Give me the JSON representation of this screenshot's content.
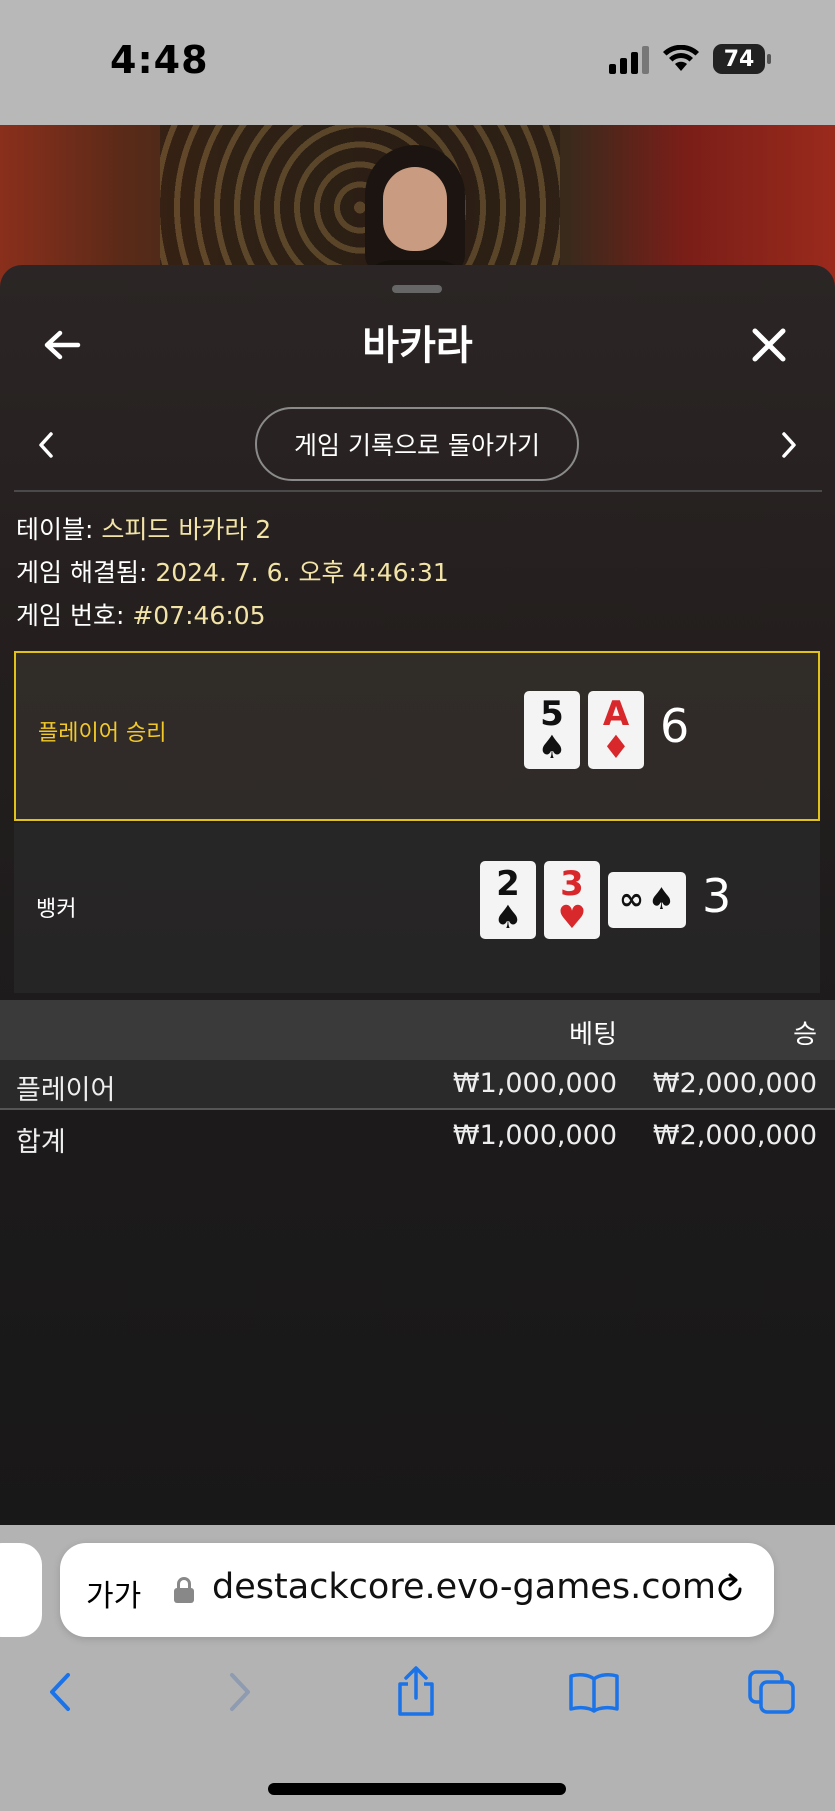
{
  "status": {
    "time": "4:48",
    "battery": "74"
  },
  "panel": {
    "title": "바카라",
    "history_button": "게임 기록으로 돌아가기",
    "info": {
      "table_label": "테이블: ",
      "table_value": "스피드 바카라 2",
      "resolved_label": "게임 해결됨: ",
      "resolved_value": "2024. 7. 6. 오후 4:46:31",
      "number_label": "게임 번호: ",
      "number_value": "#07:46:05"
    },
    "player_hand": {
      "label": "플레이어 승리",
      "cards": [
        {
          "rank": "5",
          "suit": "♠"
        },
        {
          "rank": "A",
          "suit": "♦"
        }
      ],
      "score": "6"
    },
    "banker_hand": {
      "label": "뱅커",
      "cards": [
        {
          "rank": "2",
          "suit": "♠"
        },
        {
          "rank": "3",
          "suit": "♥"
        },
        {
          "rank": "∞",
          "suit": "♠"
        }
      ],
      "score": "3"
    },
    "bets_table": {
      "headers": {
        "bet": "베팅",
        "win": "승"
      },
      "rows": [
        {
          "name": "플레이어",
          "bet": "₩1,000,000",
          "win": "₩2,000,000"
        },
        {
          "name": "합계",
          "bet": "₩1,000,000",
          "win": "₩2,000,000"
        }
      ]
    }
  },
  "browser": {
    "text_size_label": "가가",
    "url": "destackcore.evo-games.com"
  },
  "colors": {
    "accent_yellow": "#e1c21b",
    "info_value": "#f2e3a6",
    "ios_blue": "#1a73e8",
    "red_suit": "#d8282b"
  },
  "icons": {
    "back": "arrow-left-icon",
    "close": "close-icon",
    "prev": "chevron-left-icon",
    "next": "chevron-right-icon",
    "lock": "lock-icon",
    "reload": "reload-icon",
    "share": "share-icon",
    "bookmarks": "book-icon",
    "tabs": "tabs-icon"
  }
}
